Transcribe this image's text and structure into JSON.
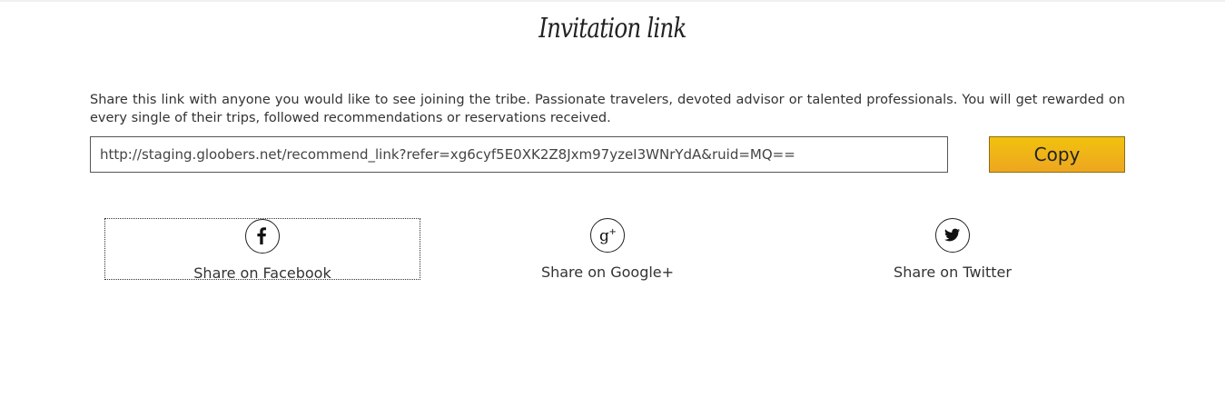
{
  "page": {
    "title": "Invitation link",
    "description": "Share this link with anyone you would like to see joining the tribe. Passionate travelers, devoted advisor or talented professionals. You will get rewarded on every single of their trips, followed recommendations or reservations received."
  },
  "link": {
    "value": "http://staging.gloobers.net/recommend_link?refer=xg6cyf5E0XK2Z8Jxm97yzeI3WNrYdA&ruid=MQ=="
  },
  "copy_button": {
    "label": "Copy"
  },
  "share": {
    "facebook": {
      "label": "Share on Facebook",
      "icon": "facebook-icon"
    },
    "google": {
      "label": "Share on Google+",
      "icon": "google-plus-icon"
    },
    "twitter": {
      "label": "Share on Twitter",
      "icon": "twitter-icon"
    }
  },
  "colors": {
    "button_top": "#f1c20e",
    "button_bottom": "#eda620",
    "text": "#333333"
  }
}
